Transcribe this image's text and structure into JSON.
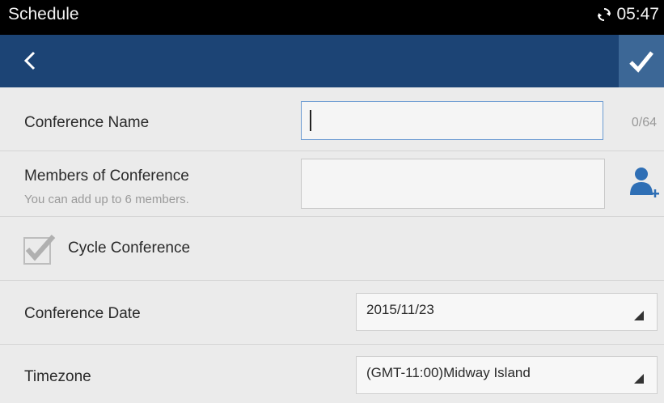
{
  "status_bar": {
    "app_title": "Schedule",
    "time": "05:47",
    "sync_icon": "sync-icon"
  },
  "action_bar": {
    "back_icon": "chevron-left-icon",
    "confirm_icon": "check-icon",
    "color": "#1c4475"
  },
  "form": {
    "conference_name": {
      "label": "Conference Name",
      "value": "",
      "counter": "0/64"
    },
    "members": {
      "label": "Members of Conference",
      "hint": "You can add up to 6 members.",
      "value": "",
      "add_icon": "add-member-icon"
    },
    "cycle": {
      "label": "Cycle Conference",
      "checked": true
    },
    "date": {
      "label": "Conference Date",
      "value": "2015/11/23"
    },
    "timezone": {
      "label": "Timezone",
      "value": "(GMT-11:00)Midway Island"
    }
  }
}
